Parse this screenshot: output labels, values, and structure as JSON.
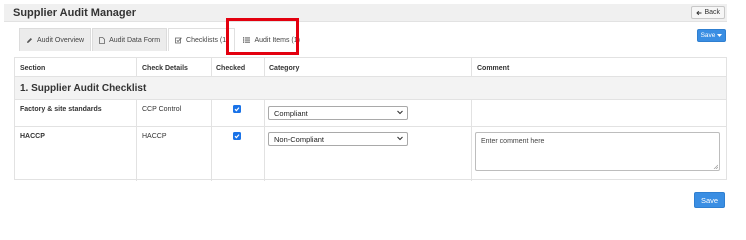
{
  "app": {
    "title": "Supplier Audit Manager",
    "back_label": "Back"
  },
  "tabs": [
    {
      "label": "Audit Overview",
      "icon": "pencil-icon"
    },
    {
      "label": "Audit Data Form",
      "icon": "document-icon"
    },
    {
      "label": "Checklists (1)",
      "icon": "checkbox-icon"
    },
    {
      "label": "Audit Items (1)",
      "icon": "list-icon"
    }
  ],
  "toolbar": {
    "save_dropdown_label": "Save"
  },
  "table": {
    "headers": [
      "Section",
      "Check Details",
      "Checked",
      "Category",
      "Comment"
    ],
    "section_title": "1. Supplier Audit Checklist",
    "rows": [
      {
        "section": "Factory & site standards",
        "check_details": "CCP Control",
        "checked": true,
        "category": "Compliant",
        "comment": ""
      },
      {
        "section": "HACCP",
        "check_details": "HACCP",
        "checked": true,
        "category": "Non-Compliant",
        "comment_placeholder": "Enter comment here"
      }
    ]
  },
  "footer": {
    "save_label": "Save"
  },
  "colors": {
    "accent": "#3a8ee3",
    "highlight": "#e3000f",
    "checkbox": "#1a73e8"
  }
}
